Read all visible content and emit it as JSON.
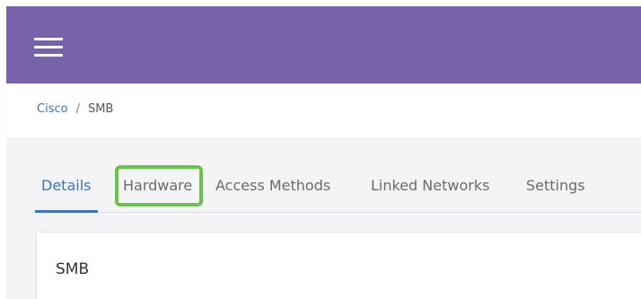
{
  "header": {
    "menu_icon": "hamburger-menu-icon",
    "background_color": "#7663aa"
  },
  "breadcrumb": {
    "parent": "Cisco",
    "separator": "/",
    "current": "SMB"
  },
  "tabs": [
    {
      "label": "Details",
      "active": true
    },
    {
      "label": "Hardware",
      "active": false,
      "highlighted": true
    },
    {
      "label": "Access Methods",
      "active": false
    },
    {
      "label": "Linked Networks",
      "active": false
    },
    {
      "label": "Settings",
      "active": false
    }
  ],
  "card": {
    "title": "SMB"
  },
  "colors": {
    "accent": "#3b73c2",
    "highlight": "#6cc14a"
  }
}
